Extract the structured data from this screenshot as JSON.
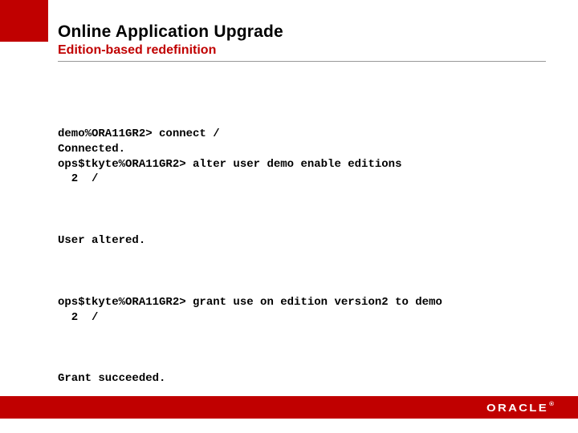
{
  "header": {
    "title": "Online Application Upgrade",
    "subtitle": "Edition-based redefinition"
  },
  "code": {
    "block1": "demo%ORA11GR2> connect /\nConnected.\nops$tkyte%ORA11GR2> alter user demo enable editions\n  2  /",
    "block2": "User altered.",
    "block3": "ops$tkyte%ORA11GR2> grant use on edition version2 to demo\n  2  /",
    "block4": "Grant succeeded."
  },
  "footer": {
    "logo": "ORACLE",
    "trademark": "®"
  }
}
